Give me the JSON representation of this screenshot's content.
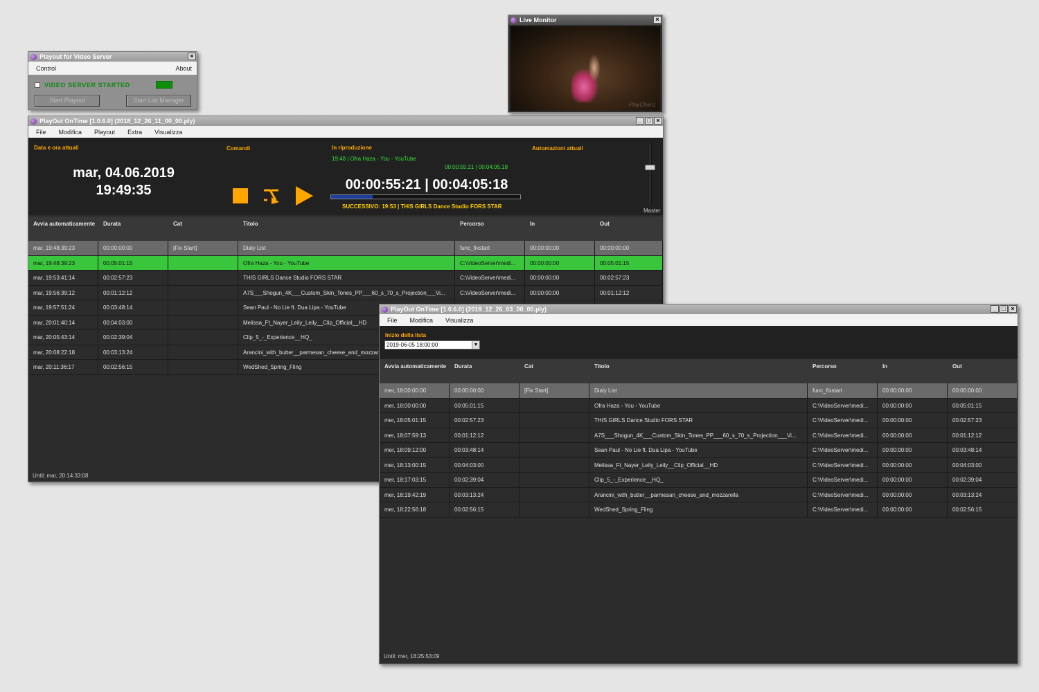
{
  "control_window": {
    "title": "Playout for Video Server",
    "menu": [
      "Control",
      "About"
    ],
    "status_text": "VIDEO SERVER STARTED",
    "start_playout_label": "Start Playout",
    "start_list_manager_label": "Start List Manager"
  },
  "live_monitor": {
    "title": "Live Monitor",
    "watermark": "PlayChan1"
  },
  "main_window": {
    "title": "PlayOut OnTime [1.0.6.0] (2018_12_26_11_00_00.ply)",
    "menu": [
      "File",
      "Modifica",
      "Playout",
      "Extra",
      "Visualizza"
    ],
    "labels": {
      "datetime": "Data e ora attuali",
      "commands": "Comandi",
      "now_playing": "In riproduzione",
      "automations": "Automazioni attuali",
      "master": "Master"
    },
    "date": "mar, 04.06.2019",
    "time": "19:49:35",
    "now_playing_title": "19:48 | Ofra Haza - You - YouTube",
    "small_counter": "00:00:55:21 | 00:04:05:18",
    "big_counter": "00:00:55:21 | 00:04:05:18",
    "progress_fraction": 0.22,
    "next_text": "SUCCESSIVO: 19:53 | THIS GIRLS  Dance Studio FORS STAR",
    "headers": [
      "Avvia automaticamente",
      "Durata",
      "Cat",
      "Titolo",
      "Percorso",
      "In",
      "Out"
    ],
    "rows": [
      [
        "mar, 19:48:39:23",
        "00:00:00:00",
        "[Fix Start]",
        "Dialy List",
        "func_fixstart",
        "00:00:00:00",
        "00:00:00:00"
      ],
      [
        "mar, 19:48:39:23",
        "00:05:01:15",
        "",
        "Ofra Haza - You - YouTube",
        "C:\\VideoServer\\medi...",
        "00:00:00:00",
        "00:05:01:15"
      ],
      [
        "mar, 19:53:41:14",
        "00:02:57:23",
        "",
        "THIS GIRLS  Dance Studio FORS STAR",
        "C:\\VideoServer\\medi...",
        "00:00:00:00",
        "00:02:57:23"
      ],
      [
        "mar, 19:56:39:12",
        "00:01:12:12",
        "",
        "A7S___Shogun_4K___Custom_Skin_Tones_PP___60_s_70_s_Projection___Vi...",
        "C:\\VideoServer\\medi...",
        "00:00:00:00",
        "00:01:12:12"
      ],
      [
        "mar, 19:57:51:24",
        "00:03:48:14",
        "",
        "Sean Paul - No Lie ft. Dua Lipa - YouTube",
        "",
        "",
        ""
      ],
      [
        "mar, 20:01:40:14",
        "00:04:03:00",
        "",
        "Melissa_Ft_Nayer_Leily_Leily__Clip_Official__HD",
        "",
        "",
        ""
      ],
      [
        "mar, 20:05:43:14",
        "00:02:39:04",
        "",
        "Clip_5_-_Experience__HQ_",
        "",
        "",
        ""
      ],
      [
        "mar, 20:08:22:18",
        "00:03:13:24",
        "",
        "Arancini_with_butter__parmesan_cheese_and_mozzarella",
        "",
        "",
        ""
      ],
      [
        "mar, 20:11:36:17",
        "00:02:56:15",
        "",
        "WedShed_Spring_Fling",
        "",
        "",
        ""
      ]
    ],
    "footer": "Until: mar, 20:14:33:08"
  },
  "list_window": {
    "title": "PlayOut OnTime [1.0.6.0] (2018_12_26_03_00_00.ply)",
    "menu": [
      "File",
      "Modifica",
      "Visualizza"
    ],
    "list_start_label": "Inizio della lista",
    "list_start_value": "2019-06-05 18:00:00",
    "headers": [
      "Avvia automaticamente",
      "Durata",
      "Cat",
      "Titolo",
      "Percorso",
      "In",
      "Out"
    ],
    "rows": [
      [
        "mer, 18:00:00:00",
        "00:00:00:00",
        "[Fix Start]",
        "Dialy List",
        "func_fixstart",
        "00:00:00:00",
        "00:00:00:00"
      ],
      [
        "mer, 18:00:00:00",
        "00:05:01:15",
        "",
        "Ofra Haza - You - YouTube",
        "C:\\VideoServer\\medi...",
        "00:00:00:00",
        "00:05:01:15"
      ],
      [
        "mer, 18:05:01:15",
        "00:02:57:23",
        "",
        "THIS GIRLS  Dance Studio FORS STAR",
        "C:\\VideoServer\\medi...",
        "00:00:00:00",
        "00:02:57:23"
      ],
      [
        "mer, 18:07:59:13",
        "00:01:12:12",
        "",
        "A7S___Shogun_4K___Custom_Skin_Tones_PP___60_s_70_s_Projection___Vi...",
        "C:\\VideoServer\\medi...",
        "00:00:00:00",
        "00:01:12:12"
      ],
      [
        "mer, 18:09:12:00",
        "00:03:48:14",
        "",
        "Sean Paul - No Lie ft. Dua Lipa - YouTube",
        "C:\\VideoServer\\medi...",
        "00:00:00:00",
        "00:03:48:14"
      ],
      [
        "mer, 18:13:00:15",
        "00:04:03:00",
        "",
        "Melissa_Ft_Nayer_Leily_Leily__Clip_Official__HD",
        "C:\\VideoServer\\medi...",
        "00:00:00:00",
        "00:04:03:00"
      ],
      [
        "mer, 18:17:03:15",
        "00:02:39:04",
        "",
        "Clip_5_-_Experience__HQ_",
        "C:\\VideoServer\\medi...",
        "00:00:00:00",
        "00:02:39:04"
      ],
      [
        "mer, 18:19:42:19",
        "00:03:13:24",
        "",
        "Arancini_with_butter__parmesan_cheese_and_mozzarella",
        "C:\\VideoServer\\medi...",
        "00:00:00:00",
        "00:03:13:24"
      ],
      [
        "mer, 18:22:56:18",
        "00:02:56:15",
        "",
        "WedShed_Spring_Fling",
        "C:\\VideoServer\\medi...",
        "00:00:00:00",
        "00:02:56:15"
      ]
    ],
    "footer": "Until: mer, 18:25:53:09"
  },
  "colors": {
    "accent_orange": "#ffaa00",
    "playing_green": "#39c53c",
    "status_green": "#0d8a10"
  }
}
